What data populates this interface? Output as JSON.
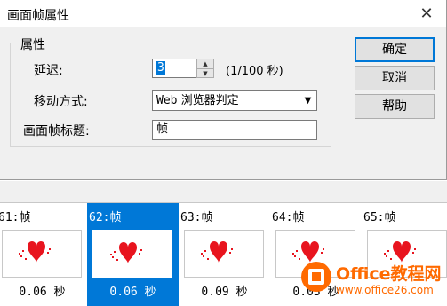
{
  "dialog": {
    "title": "画面帧属性",
    "close_glyph": "✕",
    "group_label": "属性",
    "delay_label": "延迟:",
    "delay_value": "3",
    "delay_unit": "(1/100 秒)",
    "spin_up": "▲",
    "spin_down": "▼",
    "movement_label": "移动方式:",
    "movement_value_prefix": "Web",
    "movement_value_rest": " 浏览器判定",
    "dropdown_arrow": "▼",
    "frame_title_label": "画面帧标题:",
    "frame_title_value": "帧",
    "buttons": {
      "ok": "确定",
      "cancel": "取消",
      "help": "帮助"
    }
  },
  "frames": [
    {
      "name": "61:帧",
      "delay": "0.06 秒",
      "selected": false
    },
    {
      "name": "62:帧",
      "delay": "0.06 秒",
      "selected": true
    },
    {
      "name": "63:帧",
      "delay": "0.09 秒",
      "selected": false
    },
    {
      "name": "64:帧",
      "delay": "0.03 秒",
      "selected": false
    },
    {
      "name": "65:帧",
      "delay": "",
      "selected": false
    }
  ],
  "watermark": {
    "line1": "Office教程网",
    "line2": "www.office26.com",
    "logo_color": "#ff6a00"
  },
  "colors": {
    "accent": "#0078d7",
    "heart": "#e8141e"
  }
}
